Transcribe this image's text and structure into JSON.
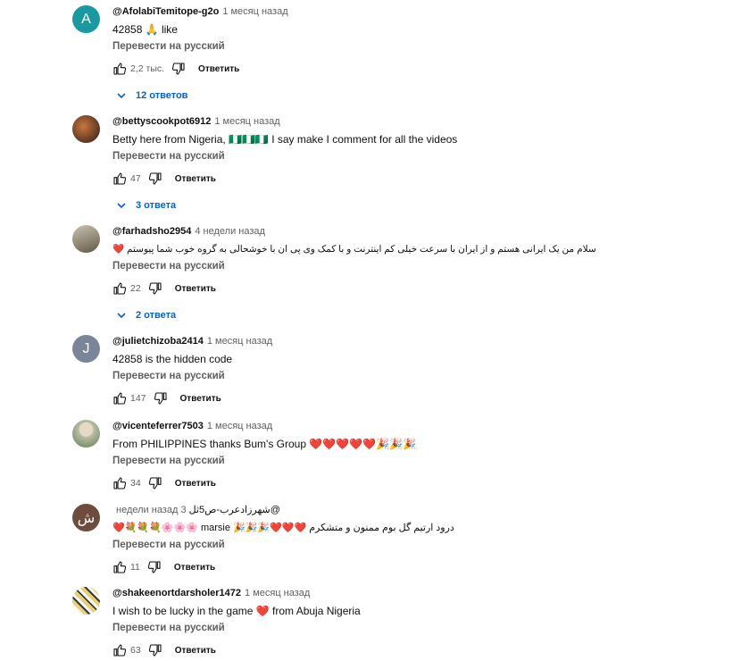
{
  "translate_label": "Перевести на русский",
  "reply_label": "Ответить",
  "comments": [
    {
      "author": "@AfolabiTemitope-g2o",
      "time": "1 месяц назад",
      "text": "42858 🙏 like",
      "likes": "2,2 тыс.",
      "replies": "12 ответов",
      "avatar_letter": "A",
      "avatar_color": "#1a9aa0"
    },
    {
      "author": "@bettyscookpot6912",
      "time": "1 месяц назад",
      "text": "Betty here from Nigeria, 🇳🇬🇳🇬🇳🇬 I say make I comment for all the videos",
      "likes": "47",
      "replies": "3 ответа",
      "avatar_letter": "",
      "avatar_color": "#6b4a2e"
    },
    {
      "author": "@farhadsho2954",
      "time": "4 недели назад",
      "text": "سلام من یک ایرانی هستم و از ایران با سرعت خیلی کم اینترنت و با کمک وی پی ان با خوشحالی به گروه خوب شما  پیوستم ❤️",
      "likes": "22",
      "replies": "2 ответа",
      "avatar_letter": "",
      "avatar_color": "#9a8f76"
    },
    {
      "author": "@julietchizoba2414",
      "time": "1 месяц назад",
      "text": "42858 is the hidden code",
      "likes": "147",
      "replies": "",
      "avatar_letter": "J",
      "avatar_color": "#79869a"
    },
    {
      "author": "@vicenteferrer7503",
      "time": "1 месяц назад",
      "text": "From PHILIPPINES thanks Bum's Group ❤️❤️❤️❤️❤️🎉🎉🎉",
      "likes": "34",
      "replies": "",
      "avatar_letter": "",
      "avatar_color": "#b8c0a8"
    },
    {
      "author": "@شهرزادعرب-ص5ثل",
      "time": "3 недели назад",
      "text": "درود ارتیم گل بوم ممنون و متشکرم ❤️❤️❤️🎉🎉🎉 marsie 🌸🌸🌸💐💐💐❤️",
      "likes": "11",
      "replies": "",
      "avatar_letter": "ش",
      "avatar_color": "#6d4c3d"
    },
    {
      "author": "@shakeenortdarsholer1472",
      "time": "1 месяц назад",
      "text": "I wish to be lucky in the game ❤️  from Abuja Nigeria",
      "likes": "63",
      "replies": "",
      "avatar_letter": "",
      "avatar_color": "#c7b24a"
    }
  ]
}
